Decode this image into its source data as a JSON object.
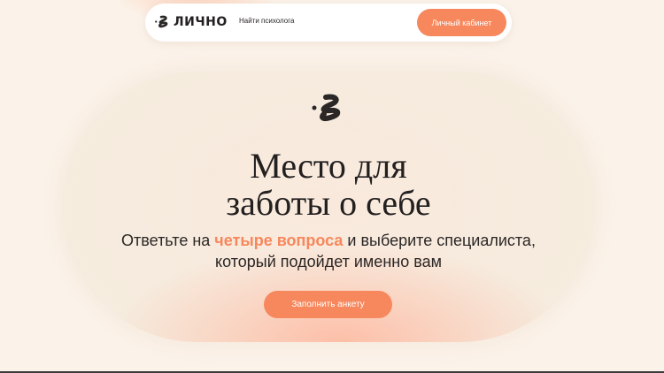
{
  "header": {
    "logo_text": "ЛИЧНО",
    "nav_link": "Найти психолога",
    "cabinet_button": "Личный кабинет"
  },
  "hero": {
    "title_line1": "Место для",
    "title_line2": "заботы о себе",
    "subtitle_before": "Ответьте на ",
    "subtitle_highlight": "четыре вопроса",
    "subtitle_after": " и выберите специалиста,",
    "subtitle_line2": "который подойдет именно вам",
    "cta_button": "Заполнить анкету"
  },
  "icons": {
    "logo": "squiggle-logo-icon",
    "hero": "squiggle-icon"
  },
  "colors": {
    "accent": "#f7875c",
    "background": "#fbf3ea",
    "text": "#232020"
  }
}
